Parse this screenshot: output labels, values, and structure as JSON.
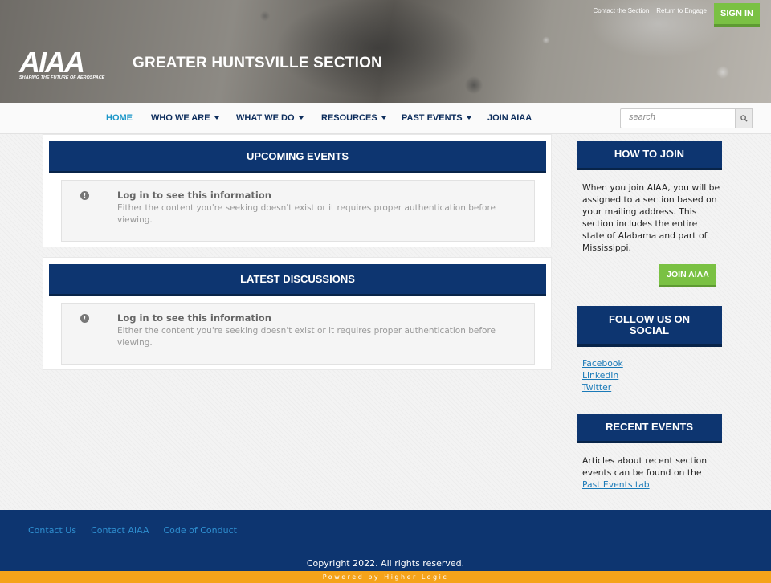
{
  "header": {
    "top_links": [
      "Contact the Section",
      "Return to Engage"
    ],
    "signin_label": "SIGN IN",
    "logo_text": "AIAA",
    "logo_tagline": "SHAPING THE FUTURE OF AEROSPACE",
    "site_title": "GREATER HUNTSVILLE SECTION"
  },
  "nav": {
    "items": [
      {
        "label": "HOME",
        "active": true
      },
      {
        "label": "WHO WE ARE"
      },
      {
        "label": "WHAT WE DO"
      },
      {
        "label": "RESOURCES"
      },
      {
        "label": "PAST EVENTS"
      },
      {
        "label": "JOIN AIAA"
      }
    ],
    "search_placeholder": "search"
  },
  "main": {
    "upcoming": {
      "title": "UPCOMING EVENTS",
      "msg_title": "Log in to see this information",
      "msg_body": "Either the content you're seeking doesn't exist or it requires proper authentication before viewing."
    },
    "discussions": {
      "title": "LATEST DISCUSSIONS",
      "msg_title": "Log in to see this information",
      "msg_body": "Either the content you're seeking doesn't exist or it requires proper authentication before viewing."
    }
  },
  "sidebar": {
    "how_to_join": {
      "title": "HOW TO JOIN",
      "text": "When you join AIAA, you will be assigned to a section based on your mailing address. This section includes the entire state of Alabama and part of Mississippi.",
      "button": "JOIN AIAA"
    },
    "social": {
      "title": "FOLLOW US ON SOCIAL",
      "links": [
        "Facebook",
        "LinkedIn",
        "Twitter"
      ]
    },
    "recent": {
      "title": "RECENT EVENTS",
      "text": "Articles about recent section events can be found on the ",
      "link": "Past Events tab"
    }
  },
  "footer": {
    "links": [
      "Contact Us",
      "Contact AIAA",
      "Code of Conduct"
    ],
    "copyright": "Copyright 2022. All rights reserved.",
    "powered": "Powered by Higher Logic"
  },
  "colors": {
    "navy": "#0d3570",
    "green": "#7ac143",
    "orange": "#f5a31a",
    "link": "#1a7ab8"
  }
}
